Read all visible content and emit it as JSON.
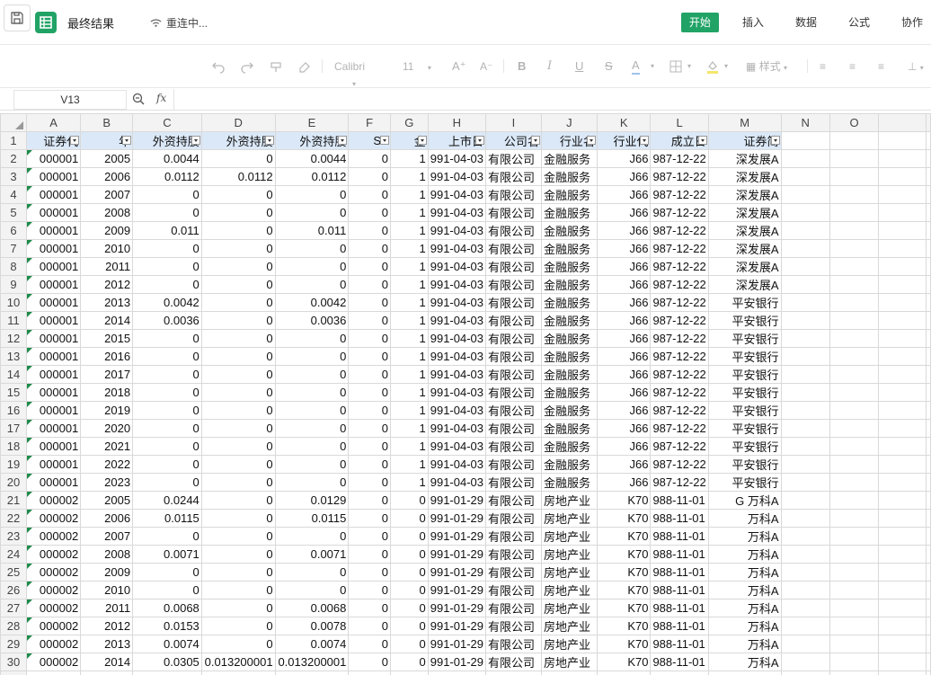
{
  "titlebar": {
    "doc_title": "最终结果",
    "connection_status": "重连中...",
    "tabs": [
      "开始",
      "插入",
      "数据",
      "公式",
      "协作"
    ],
    "active_tab": "开始"
  },
  "toolbar": {
    "font_name": "Calibri",
    "font_size": "11",
    "style_label": "样式"
  },
  "formula_bar": {
    "cell_ref": "V13",
    "fx_label": "fx",
    "formula": ""
  },
  "columns": [
    "A",
    "B",
    "C",
    "D",
    "E",
    "F",
    "G",
    "H",
    "I",
    "J",
    "K",
    "L",
    "M",
    "N",
    "O"
  ],
  "header_row": [
    "证券代",
    "年",
    "外资持股",
    "外资持股",
    "外资持股",
    "ST",
    "金",
    "上市日",
    "公司名",
    "行业名",
    "行业代",
    "成立日",
    "证券简"
  ],
  "rows": [
    [
      "000001",
      "2005",
      "0.0044",
      "0",
      "0.0044",
      "0",
      "1",
      "991-04-03",
      "有限公司",
      "金融服务",
      "J66",
      "987-12-22",
      "深发展A"
    ],
    [
      "000001",
      "2006",
      "0.0112",
      "0.0112",
      "0.0112",
      "0",
      "1",
      "991-04-03",
      "有限公司",
      "金融服务",
      "J66",
      "987-12-22",
      "深发展A"
    ],
    [
      "000001",
      "2007",
      "0",
      "0",
      "0",
      "0",
      "1",
      "991-04-03",
      "有限公司",
      "金融服务",
      "J66",
      "987-12-22",
      "深发展A"
    ],
    [
      "000001",
      "2008",
      "0",
      "0",
      "0",
      "0",
      "1",
      "991-04-03",
      "有限公司",
      "金融服务",
      "J66",
      "987-12-22",
      "深发展A"
    ],
    [
      "000001",
      "2009",
      "0.011",
      "0",
      "0.011",
      "0",
      "1",
      "991-04-03",
      "有限公司",
      "金融服务",
      "J66",
      "987-12-22",
      "深发展A"
    ],
    [
      "000001",
      "2010",
      "0",
      "0",
      "0",
      "0",
      "1",
      "991-04-03",
      "有限公司",
      "金融服务",
      "J66",
      "987-12-22",
      "深发展A"
    ],
    [
      "000001",
      "2011",
      "0",
      "0",
      "0",
      "0",
      "1",
      "991-04-03",
      "有限公司",
      "金融服务",
      "J66",
      "987-12-22",
      "深发展A"
    ],
    [
      "000001",
      "2012",
      "0",
      "0",
      "0",
      "0",
      "1",
      "991-04-03",
      "有限公司",
      "金融服务",
      "J66",
      "987-12-22",
      "深发展A"
    ],
    [
      "000001",
      "2013",
      "0.0042",
      "0",
      "0.0042",
      "0",
      "1",
      "991-04-03",
      "有限公司",
      "金融服务",
      "J66",
      "987-12-22",
      "平安银行"
    ],
    [
      "000001",
      "2014",
      "0.0036",
      "0",
      "0.0036",
      "0",
      "1",
      "991-04-03",
      "有限公司",
      "金融服务",
      "J66",
      "987-12-22",
      "平安银行"
    ],
    [
      "000001",
      "2015",
      "0",
      "0",
      "0",
      "0",
      "1",
      "991-04-03",
      "有限公司",
      "金融服务",
      "J66",
      "987-12-22",
      "平安银行"
    ],
    [
      "000001",
      "2016",
      "0",
      "0",
      "0",
      "0",
      "1",
      "991-04-03",
      "有限公司",
      "金融服务",
      "J66",
      "987-12-22",
      "平安银行"
    ],
    [
      "000001",
      "2017",
      "0",
      "0",
      "0",
      "0",
      "1",
      "991-04-03",
      "有限公司",
      "金融服务",
      "J66",
      "987-12-22",
      "平安银行"
    ],
    [
      "000001",
      "2018",
      "0",
      "0",
      "0",
      "0",
      "1",
      "991-04-03",
      "有限公司",
      "金融服务",
      "J66",
      "987-12-22",
      "平安银行"
    ],
    [
      "000001",
      "2019",
      "0",
      "0",
      "0",
      "0",
      "1",
      "991-04-03",
      "有限公司",
      "金融服务",
      "J66",
      "987-12-22",
      "平安银行"
    ],
    [
      "000001",
      "2020",
      "0",
      "0",
      "0",
      "0",
      "1",
      "991-04-03",
      "有限公司",
      "金融服务",
      "J66",
      "987-12-22",
      "平安银行"
    ],
    [
      "000001",
      "2021",
      "0",
      "0",
      "0",
      "0",
      "1",
      "991-04-03",
      "有限公司",
      "金融服务",
      "J66",
      "987-12-22",
      "平安银行"
    ],
    [
      "000001",
      "2022",
      "0",
      "0",
      "0",
      "0",
      "1",
      "991-04-03",
      "有限公司",
      "金融服务",
      "J66",
      "987-12-22",
      "平安银行"
    ],
    [
      "000001",
      "2023",
      "0",
      "0",
      "0",
      "0",
      "1",
      "991-04-03",
      "有限公司",
      "金融服务",
      "J66",
      "987-12-22",
      "平安银行"
    ],
    [
      "000002",
      "2005",
      "0.0244",
      "0",
      "0.0129",
      "0",
      "0",
      "991-01-29",
      "有限公司",
      "房地产业",
      "K70",
      "988-11-01",
      "G 万科A"
    ],
    [
      "000002",
      "2006",
      "0.0115",
      "0",
      "0.0115",
      "0",
      "0",
      "991-01-29",
      "有限公司",
      "房地产业",
      "K70",
      "988-11-01",
      "万科A"
    ],
    [
      "000002",
      "2007",
      "0",
      "0",
      "0",
      "0",
      "0",
      "991-01-29",
      "有限公司",
      "房地产业",
      "K70",
      "988-11-01",
      "万科A"
    ],
    [
      "000002",
      "2008",
      "0.0071",
      "0",
      "0.0071",
      "0",
      "0",
      "991-01-29",
      "有限公司",
      "房地产业",
      "K70",
      "988-11-01",
      "万科A"
    ],
    [
      "000002",
      "2009",
      "0",
      "0",
      "0",
      "0",
      "0",
      "991-01-29",
      "有限公司",
      "房地产业",
      "K70",
      "988-11-01",
      "万科A"
    ],
    [
      "000002",
      "2010",
      "0",
      "0",
      "0",
      "0",
      "0",
      "991-01-29",
      "有限公司",
      "房地产业",
      "K70",
      "988-11-01",
      "万科A"
    ],
    [
      "000002",
      "2011",
      "0.0068",
      "0",
      "0.0068",
      "0",
      "0",
      "991-01-29",
      "有限公司",
      "房地产业",
      "K70",
      "988-11-01",
      "万科A"
    ],
    [
      "000002",
      "2012",
      "0.0153",
      "0",
      "0.0078",
      "0",
      "0",
      "991-01-29",
      "有限公司",
      "房地产业",
      "K70",
      "988-11-01",
      "万科A"
    ],
    [
      "000002",
      "2013",
      "0.0074",
      "0",
      "0.0074",
      "0",
      "0",
      "991-01-29",
      "有限公司",
      "房地产业",
      "K70",
      "988-11-01",
      "万科A"
    ],
    [
      "000002",
      "2014",
      "0.0305",
      "0.013200001",
      "0.013200001",
      "0",
      "0",
      "991-01-29",
      "有限公司",
      "房地产业",
      "K70",
      "988-11-01",
      "万科A"
    ]
  ],
  "colors": {
    "accent": "#21a366",
    "header_fill": "#dbe8f7",
    "error_triangle": "#1e8a4a"
  }
}
